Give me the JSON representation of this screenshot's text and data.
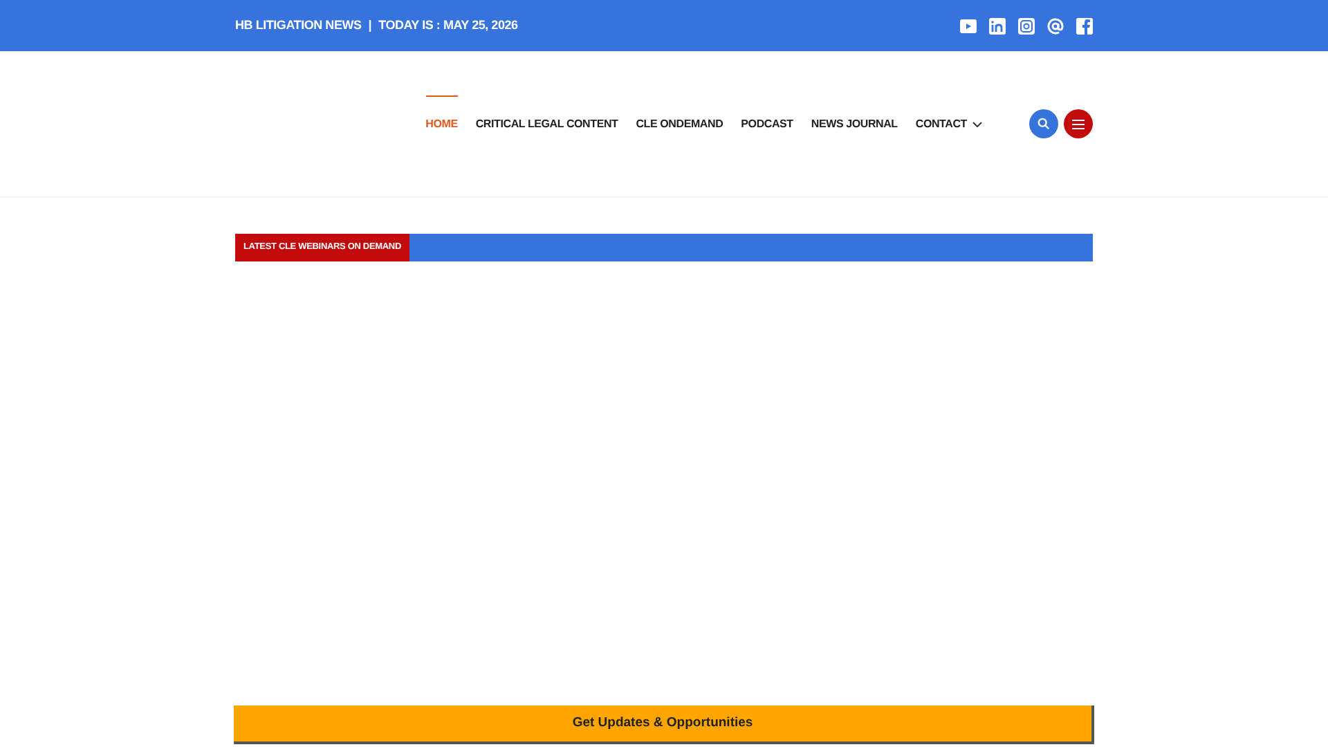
{
  "top_bar": {
    "site_name": "HB LITIGATION NEWS",
    "separator": "|",
    "date": "TODAY IS : MAY 25, 2026",
    "social": [
      {
        "kind": "youtube"
      },
      {
        "kind": "linkedin"
      },
      {
        "kind": "instagram"
      },
      {
        "kind": "email"
      },
      {
        "kind": "facebook"
      }
    ]
  },
  "nav": {
    "items": [
      {
        "label": "HOME",
        "selected": true,
        "dropdown": false
      },
      {
        "label": "CRITICAL LEGAL CONTENT",
        "selected": false,
        "dropdown": false
      },
      {
        "label": "CLE ONDEMAND",
        "selected": false,
        "dropdown": false
      },
      {
        "label": "PODCAST",
        "selected": false,
        "dropdown": false
      },
      {
        "label": "NEWS JOURNAL",
        "selected": false,
        "dropdown": false
      },
      {
        "label": "CONTACT",
        "selected": false,
        "dropdown": true
      }
    ]
  },
  "ticker": {
    "label": "LATEST CLE WEBINARS ON DEMAND"
  },
  "cta": {
    "label": "Get Updates & Opportunities"
  }
}
